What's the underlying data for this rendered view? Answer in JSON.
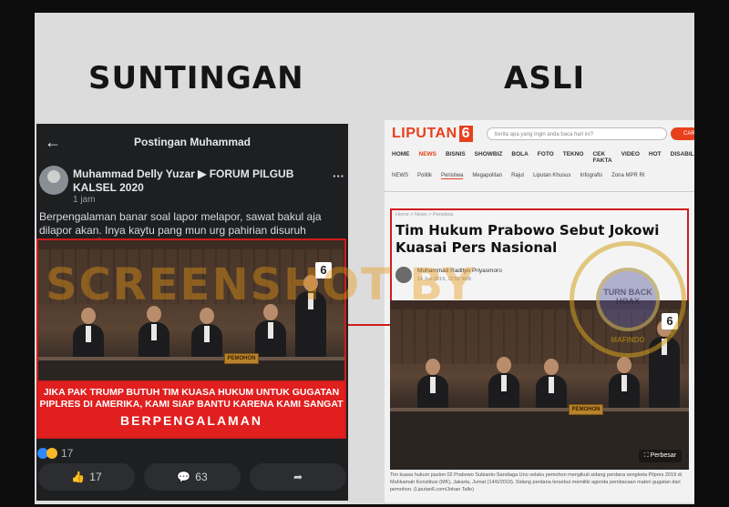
{
  "headings": {
    "left": "SUNTINGAN",
    "right": "ASLI"
  },
  "facebook": {
    "back_icon": "arrow-left-icon",
    "title": "Postingan Muhammad",
    "author": "Muhammad Delly Yuzar ▶ FORUM PILGUB KALSEL 2020",
    "time": "1 jam",
    "more": "···",
    "text": "Berpengalaman banar soal lapor melapor,  sawat bakul aja dilapor akan. Inya kaytu pang mun urg pahirian disuruh mencalon. 😁",
    "image_caption_line1": "JIKA PAK TRUMP BUTUH TIM KUASA HUKUM UNTUK GUGATAN PIPLRES DI AMERIKA, KAMI SIAP BANTU KARENA KAMI SANGAT",
    "image_caption_line2": "BERPENGALAMAN",
    "reaction_count": "17",
    "like_count": "17",
    "comment_count": "63",
    "channel_logo": "6",
    "plaque_text": "PEMOHON"
  },
  "watermark": "SCREENSHOT BY",
  "liputan": {
    "logo_text": "LIPUTAN",
    "logo_six": "6",
    "search_placeholder": "berita apa yang ingin anda baca hari ini?",
    "search_button": "CARI",
    "nav": [
      "HOME",
      "NEWS",
      "BISNIS",
      "SHOWBIZ",
      "BOLA",
      "FOTO",
      "TEKNO",
      "CEK FAKTA",
      "VIDEO",
      "HOT",
      "DISABILITAS"
    ],
    "nav_active": "NEWS",
    "subnav": [
      "NEWS",
      "Politik",
      "Peristiwa",
      "Megapolitan",
      "Rajut",
      "Liputan Khusus",
      "Infografis",
      "Zona MPR RI"
    ],
    "subnav_active": "Peristiwa",
    "crumb": "Home > News > Peristiwa",
    "title": "Tim Hukum Prabowo Sebut Jokowi Kuasai Pers Nasional",
    "author": "Muhammad Radityo Priyasmoro",
    "date": "14 Jun 2019, 12:55 WIB",
    "perbesar": "⛶ Perbesar",
    "caption": "Tim kuasa hukum paslon 02 Prabowo Subianto-Sandiaga Uno selaku pemohon mengikuti sidang perdana sengketa Pilpres 2019 di Mahkamah Konstitusi (MK), Jakarta, Jumat (14/6/2019). Sidang perdana tersebut memiliki agenda pembacaan materi gugatan dari pemohon. (Liputan6.com/Johan Tallo)",
    "photo_logo": "6",
    "plaque_text": "PEMOHON"
  },
  "seal": {
    "top": "TURN BACK HOAX",
    "ring": "MAFINDO"
  }
}
